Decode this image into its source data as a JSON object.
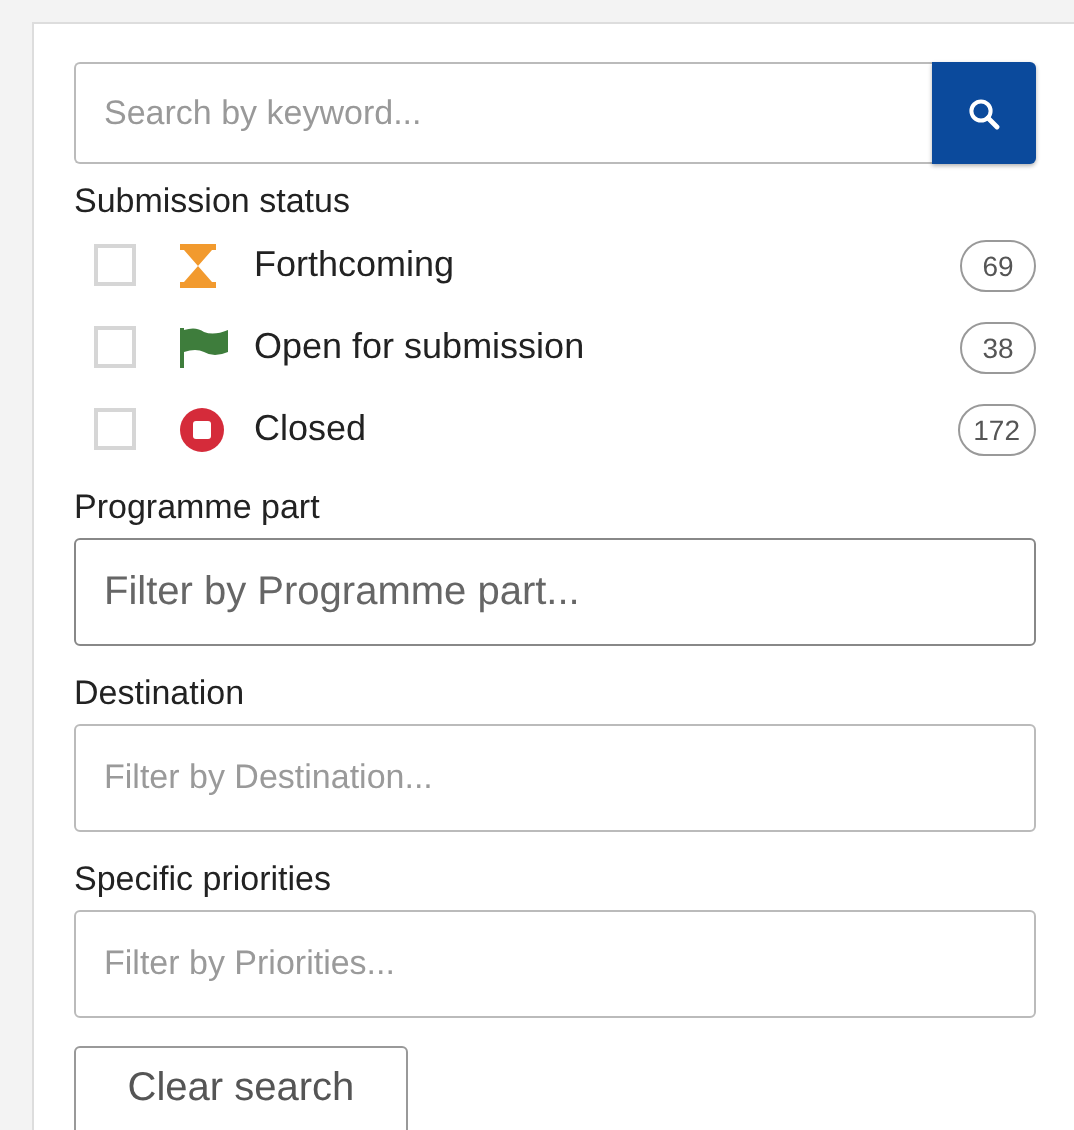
{
  "search": {
    "placeholder": "Search by keyword..."
  },
  "submission_status": {
    "label": "Submission status",
    "items": [
      {
        "kind": "hourglass",
        "label": "Forthcoming",
        "count": "69",
        "checked": false
      },
      {
        "kind": "flag",
        "label": "Open for submission",
        "count": "38",
        "checked": false
      },
      {
        "kind": "stop",
        "label": "Closed",
        "count": "172",
        "checked": false
      }
    ]
  },
  "filters": [
    {
      "label": "Programme part",
      "placeholder": "Filter by Programme part...",
      "kind": "large"
    },
    {
      "label": "Destination",
      "placeholder": "Filter by Destination...",
      "kind": "normal"
    },
    {
      "label": "Specific priorities",
      "placeholder": "Filter by Priorities...",
      "kind": "normal"
    }
  ],
  "clear_button": "Clear search"
}
